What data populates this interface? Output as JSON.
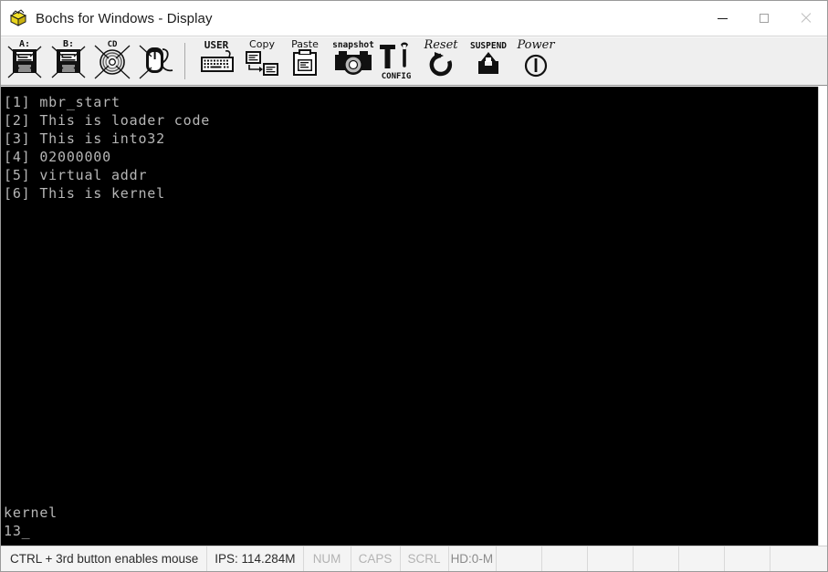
{
  "window": {
    "title": "Bochs for Windows - Display",
    "icon": "bochs-box-icon",
    "controls": {
      "minimize_label": "Minimize",
      "maximize_label": "Maximize",
      "close_label": "Close"
    }
  },
  "toolbar": {
    "buttons": [
      {
        "name": "floppy-a-button",
        "label": "A:",
        "icon": "floppy-disk-icon",
        "state": "disabled"
      },
      {
        "name": "floppy-b-button",
        "label": "B:",
        "icon": "floppy-disk-icon",
        "state": "disabled"
      },
      {
        "name": "cdrom-button",
        "label": "CD",
        "icon": "cdrom-icon",
        "state": "disabled"
      },
      {
        "name": "mouse-button",
        "label": "",
        "icon": "mouse-icon",
        "state": "disabled"
      },
      {
        "name": "user-button",
        "label": "USER",
        "icon": "keyboard-icon",
        "state": "enabled"
      },
      {
        "name": "copy-button",
        "label": "Copy",
        "icon": "copy-icon",
        "state": "enabled"
      },
      {
        "name": "paste-button",
        "label": "Paste",
        "icon": "paste-icon",
        "state": "enabled"
      },
      {
        "name": "snapshot-button",
        "label": "Snapshot",
        "icon": "camera-icon",
        "state": "enabled"
      },
      {
        "name": "config-button",
        "label": "CONFIG",
        "icon": "tools-icon",
        "state": "enabled"
      },
      {
        "name": "reset-button",
        "label": "Reset",
        "icon": "reset-arrow-icon",
        "state": "enabled"
      },
      {
        "name": "suspend-button",
        "label": "SUSPEND",
        "icon": "suspend-icon",
        "state": "enabled"
      },
      {
        "name": "power-button",
        "label": "Power",
        "icon": "power-icon",
        "state": "enabled"
      }
    ]
  },
  "display": {
    "background_color": "#000000",
    "text_color": "#b6b6b6",
    "boot_log": "[1] mbr_start\n[2] This is loader code\n[3] This is into32\n[4] 02000000\n[5] virtual addr\n[6] This is kernel",
    "lower_output": "kernel\n13_",
    "cursor": "_"
  },
  "statusbar": {
    "message": "CTRL + 3rd button enables mouse",
    "ips": "IPS: 114.284M",
    "indicators": [
      {
        "label": "NUM",
        "active": false
      },
      {
        "label": "CAPS",
        "active": false
      },
      {
        "label": "SCRL",
        "active": false
      },
      {
        "label": "HD:0-M",
        "active": false
      }
    ]
  }
}
